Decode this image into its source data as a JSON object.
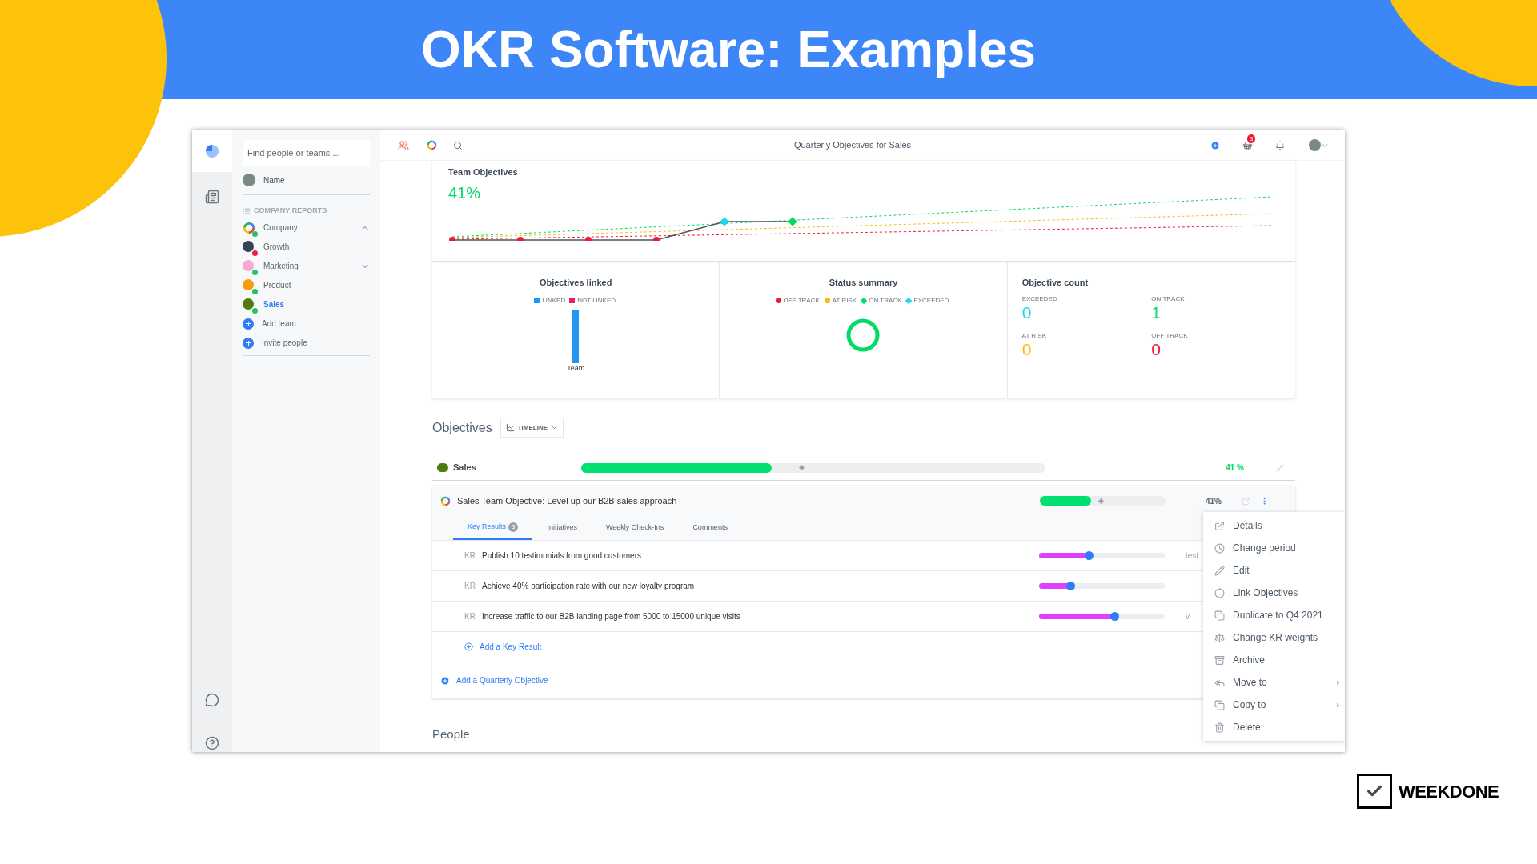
{
  "banner": {
    "title": "OKR Software: Examples"
  },
  "topbar": {
    "title": "Quarterly Objectives for Sales",
    "badge": "3"
  },
  "sidebar": {
    "search_placeholder": "Find people or teams ...",
    "user": "Name",
    "section": "COMPANY REPORTS",
    "items": [
      {
        "kind": "team",
        "label": "Company",
        "selected": false,
        "color": "#22c55e",
        "expanded": true
      },
      {
        "kind": "team",
        "label": "Growth",
        "selected": false,
        "color": "#ef1d4a"
      },
      {
        "kind": "team",
        "label": "Marketing",
        "selected": false,
        "color": "#22c55e",
        "expanded": false
      },
      {
        "kind": "team",
        "label": "Product",
        "selected": false,
        "color": "#22c55e"
      },
      {
        "kind": "team",
        "label": "Sales",
        "selected": true,
        "color": "#22c55e"
      },
      {
        "kind": "action",
        "label": "Add team"
      },
      {
        "kind": "action",
        "label": "Invite people"
      }
    ]
  },
  "team_objectives": {
    "title": "Team Objectives",
    "value": "41%"
  },
  "objectives_linked": {
    "title": "Objectives linked",
    "legend": [
      {
        "label": "LINKED",
        "color": "#2196f3"
      },
      {
        "label": "NOT LINKED",
        "color": "#e91e63"
      }
    ],
    "bar_label": "Team"
  },
  "status_summary": {
    "title": "Status summary",
    "legend": [
      {
        "label": "OFF TRACK",
        "color": "#f0193c",
        "kind": "dot"
      },
      {
        "label": "AT RISK",
        "color": "#fbbc05",
        "kind": "dot"
      },
      {
        "label": "ON TRACK",
        "color": "#00dc64",
        "kind": "diamond"
      },
      {
        "label": "EXCEEDED",
        "color": "#1ed6f0",
        "kind": "diamond"
      }
    ]
  },
  "objective_count": {
    "title": "Objective count",
    "items": [
      {
        "label": "EXCEEDED",
        "value": "0",
        "color": "#1ed6f0"
      },
      {
        "label": "ON TRACK",
        "value": "1",
        "color": "#00dc64"
      },
      {
        "label": "AT RISK",
        "value": "0",
        "color": "#fbbc05"
      },
      {
        "label": "OFF TRACK",
        "value": "0",
        "color": "#f0193c"
      }
    ]
  },
  "objectives": {
    "heading": "Objectives",
    "view": "TIMELINE",
    "team": {
      "name": "Sales",
      "level": 0.41,
      "percent": "41 %"
    },
    "objective": {
      "title": "Sales Team Objective: Level up our B2B sales approach",
      "level": 0.41,
      "percent": "41%",
      "tabs": [
        {
          "label": "Key Results",
          "count": "3",
          "selected": true
        },
        {
          "label": "Initiatives",
          "selected": false
        },
        {
          "label": "Weekly Check-Ins",
          "selected": false
        },
        {
          "label": "Comments",
          "selected": false
        }
      ],
      "key_results": [
        {
          "prefix": "KR",
          "text": "Publish 10 testimonials from good customers",
          "level": 0.4,
          "note": "test"
        },
        {
          "prefix": "KR",
          "text": "Achieve 40% participation rate with our new loyalty program",
          "level": 0.25
        },
        {
          "prefix": "KR",
          "text": "Increase traffic to our B2B landing page from 5000 to 15000 unique visits",
          "level": 0.6,
          "note": "v"
        }
      ],
      "add_key_result": "Add a Key Result"
    },
    "add_objective": "Add a Quarterly Objective"
  },
  "people": {
    "heading": "People"
  },
  "menu": [
    {
      "label": "Details",
      "submenu": false
    },
    {
      "label": "Change period",
      "submenu": false
    },
    {
      "label": "Edit",
      "submenu": false
    },
    {
      "label": "Link Objectives",
      "submenu": false
    },
    {
      "label": "Duplicate to Q4 2021",
      "submenu": false
    },
    {
      "label": "Change KR weights",
      "submenu": false
    },
    {
      "label": "Archive",
      "submenu": false
    },
    {
      "label": "Move to",
      "submenu": true
    },
    {
      "label": "Copy to",
      "submenu": true
    },
    {
      "label": "Delete",
      "submenu": false
    }
  ],
  "logo": {
    "text": "WEEKDONE"
  }
}
